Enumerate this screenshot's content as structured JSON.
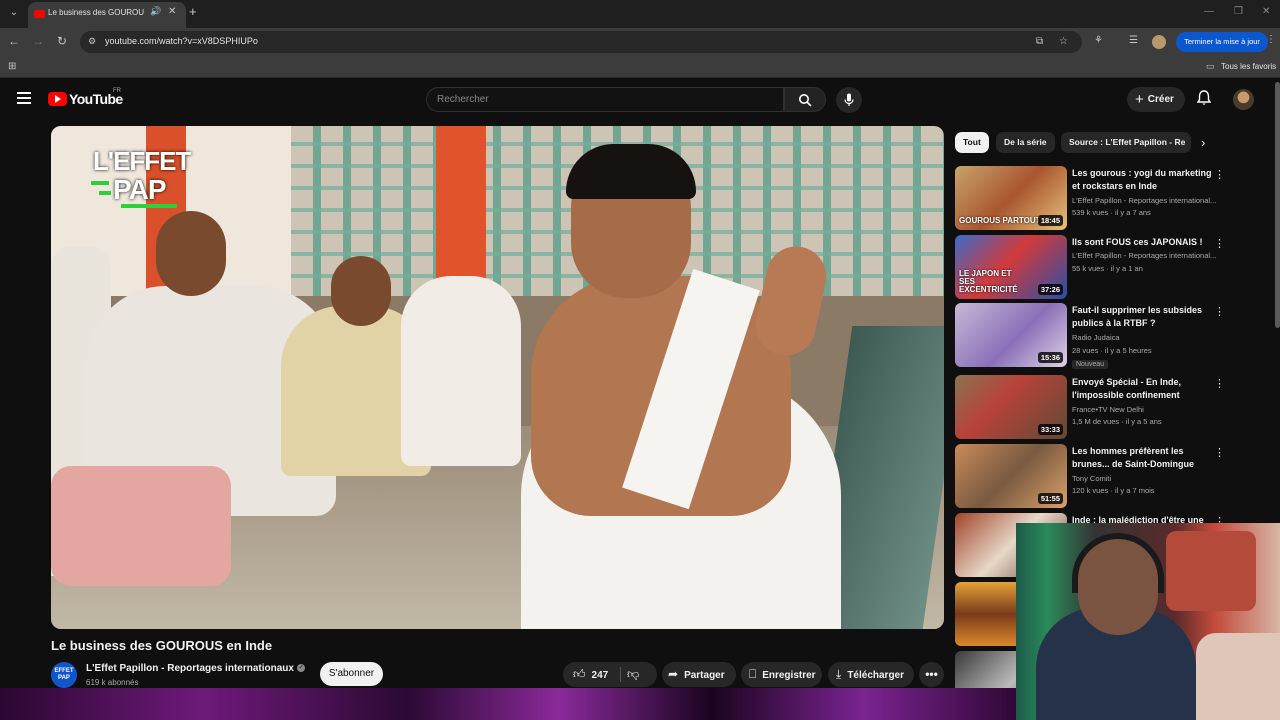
{
  "browser": {
    "tab_title": "Le business des GOUROUS",
    "tab_audio_icon": "speaker-icon",
    "url": "youtube.com/watch?v=xV8DSPHIUPo",
    "update_button": "Terminer la mise à jour",
    "bookmarks_all": "Tous les favoris"
  },
  "header": {
    "logo_text": "YouTube",
    "logo_region": "FR",
    "search_placeholder": "Rechercher",
    "create_label": "Créer"
  },
  "video": {
    "watermark_line1": "L'EFFET",
    "watermark_line2": "PAP",
    "title": "Le business des GOUROUS en Inde",
    "channel": "L'Effet Papillon - Reportages internationaux",
    "channel_avatar_text": "EFFET PAP",
    "subscribers": "619 k abonnés",
    "subscribe_label": "S'abonner",
    "likes": "247",
    "share_label": "Partager",
    "save_label": "Enregistrer",
    "download_label": "Télécharger"
  },
  "chips": [
    "Tout",
    "De la série",
    "Source : L'Effet Papillon - Re"
  ],
  "recommendations": [
    {
      "title": "Les gourous : yogi du marketing et rockstars en Inde",
      "channel": "L'Effet Papillon - Reportages international...",
      "meta": "539 k vues · il y a 7 ans",
      "duration": "18:45",
      "overlay": "GOUROUS PARTOUT",
      "badge": ""
    },
    {
      "title": "Ils sont FOUS ces JAPONAIS !",
      "channel": "L'Effet Papillon - Reportages international...",
      "meta": "55 k vues · il y a 1 an",
      "duration": "37:26",
      "overlay": "LE JAPON ET SES EXCENTRICITÉ",
      "badge": ""
    },
    {
      "title": "Faut-il supprimer les subsides publics à la RTBF ?",
      "channel": "Radio Judaica",
      "meta": "28 vues · il y a 5 heures",
      "duration": "15:36",
      "overlay": "",
      "badge": "Nouveau"
    },
    {
      "title": "Envoyé Spécial - En Inde, l'impossible confinement",
      "channel": "France•TV New Delhi",
      "meta": "1,5 M de vues · il y a 5 ans",
      "duration": "33:33",
      "overlay": "",
      "badge": ""
    },
    {
      "title": "Les hommes préfèrent les brunes... de Saint-Domingue",
      "channel": "Tony Comiti",
      "meta": "120 k vues · il y a 7 mois",
      "duration": "51:55",
      "overlay": "",
      "badge": ""
    },
    {
      "title": "Inde : la malédiction d'être une",
      "channel": "",
      "meta": "",
      "duration": "",
      "overlay": "",
      "badge": ""
    }
  ]
}
